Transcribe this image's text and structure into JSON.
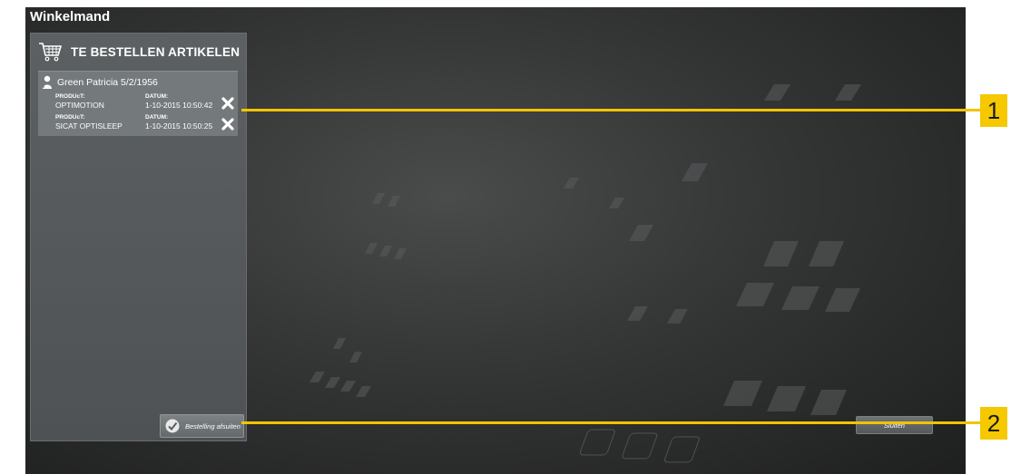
{
  "window": {
    "title": "Winkelmand"
  },
  "cart": {
    "title": "TE BESTELLEN ARTIKELEN",
    "patient": "Green Patricia 5/2/1956",
    "orders": [
      {
        "product_label": "PRODUcT:",
        "product": "OPTIMOTION",
        "date_label": "DATUM:",
        "date": "1-10-2015 10:50:42"
      },
      {
        "product_label": "PRODUcT:",
        "product": "SICAT OPTISLEEP",
        "date_label": "DATUM:",
        "date": "1-10-2015 10:50:25"
      }
    ],
    "confirm_label": "Bestelling afsuiten"
  },
  "close_label": "Sluiten",
  "callouts": [
    "1",
    "2"
  ],
  "colors": {
    "callout": "#f5c800",
    "panel": "#565a5c",
    "background": "#343535"
  }
}
